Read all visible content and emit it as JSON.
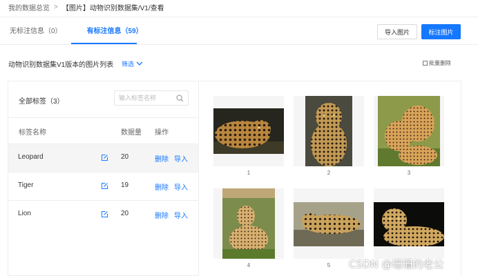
{
  "breadcrumb": {
    "root": "我的数据总览",
    "separator": ">",
    "current": "【图片】动物识别数据集/V1/查看"
  },
  "tabs": [
    {
      "label": "无标注信息（0）",
      "active": false
    },
    {
      "label": "有标注信息（59）",
      "active": true
    }
  ],
  "actions": {
    "import_label": "导入图片",
    "tag_label": "标注图片"
  },
  "list": {
    "title": "动物识别数据集V1版本的图片列表",
    "filter_label": "筛选",
    "batch_delete_label": "批量删除"
  },
  "tag_panel": {
    "title": "全部标签（3）",
    "search_placeholder": "输入标签名称",
    "columns": {
      "name": "标签名称",
      "count": "数据量",
      "ops": "操作"
    },
    "rows": [
      {
        "name": "Leopard",
        "count": "20",
        "delete": "删除",
        "import": "导入"
      },
      {
        "name": "Tiger",
        "count": "19",
        "delete": "删除",
        "import": "导入"
      },
      {
        "name": "Lion",
        "count": "20",
        "delete": "删除",
        "import": "导入"
      }
    ]
  },
  "images": [
    {
      "caption": "1",
      "subject": "leopard"
    },
    {
      "caption": "2",
      "subject": "leopard"
    },
    {
      "caption": "3",
      "subject": "cheetah"
    },
    {
      "caption": "4",
      "subject": "cheetah"
    },
    {
      "caption": "5",
      "subject": "leopard"
    },
    {
      "caption": "6",
      "subject": "leopard"
    }
  ],
  "watermark": "CSDN @珊珊的老公",
  "colors": {
    "accent": "#1677ff",
    "border": "#eeeeee",
    "selected_row": "#f5f5f5"
  }
}
